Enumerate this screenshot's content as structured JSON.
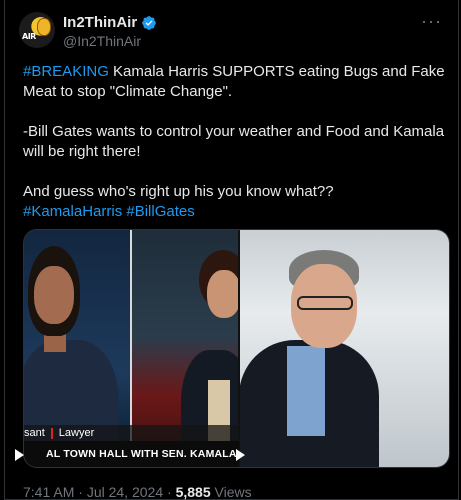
{
  "author": {
    "display_name": "In2ThinAir",
    "handle": "@In2ThinAir",
    "avatar_text": "AIR",
    "verified": true,
    "verified_icon": "verified-badge-icon"
  },
  "more_icon": "more-horizontal-icon",
  "tweet": {
    "line1_hashtag": "#BREAKING",
    "line1_text": " Kamala Harris SUPPORTS eating Bugs and Fake Meat to stop \"Climate Change\".",
    "line2_text": "-Bill Gates wants to control your weather and Food and Kamala will be right there!",
    "line3_text": "And guess who's right up his you know what??",
    "hashtag1": "#KamalaHarris",
    "hashtag2": "#BillGates"
  },
  "media": {
    "lower_third_name": "sant",
    "lower_third_role": "Lawyer",
    "lower_third_banner": "AL TOWN HALL WITH SEN. KAMALA HARR",
    "play_icon": "play-icon"
  },
  "meta": {
    "time": "7:41 AM",
    "sep1": " · ",
    "date": "Jul 24, 2024",
    "sep2": " · ",
    "views_count": "5,885",
    "views_label": " Views"
  },
  "colors": {
    "background": "#000000",
    "text": "#e7e9ea",
    "muted": "#71767b",
    "link": "#1d9bf0",
    "verified": "#1d9bf0"
  }
}
